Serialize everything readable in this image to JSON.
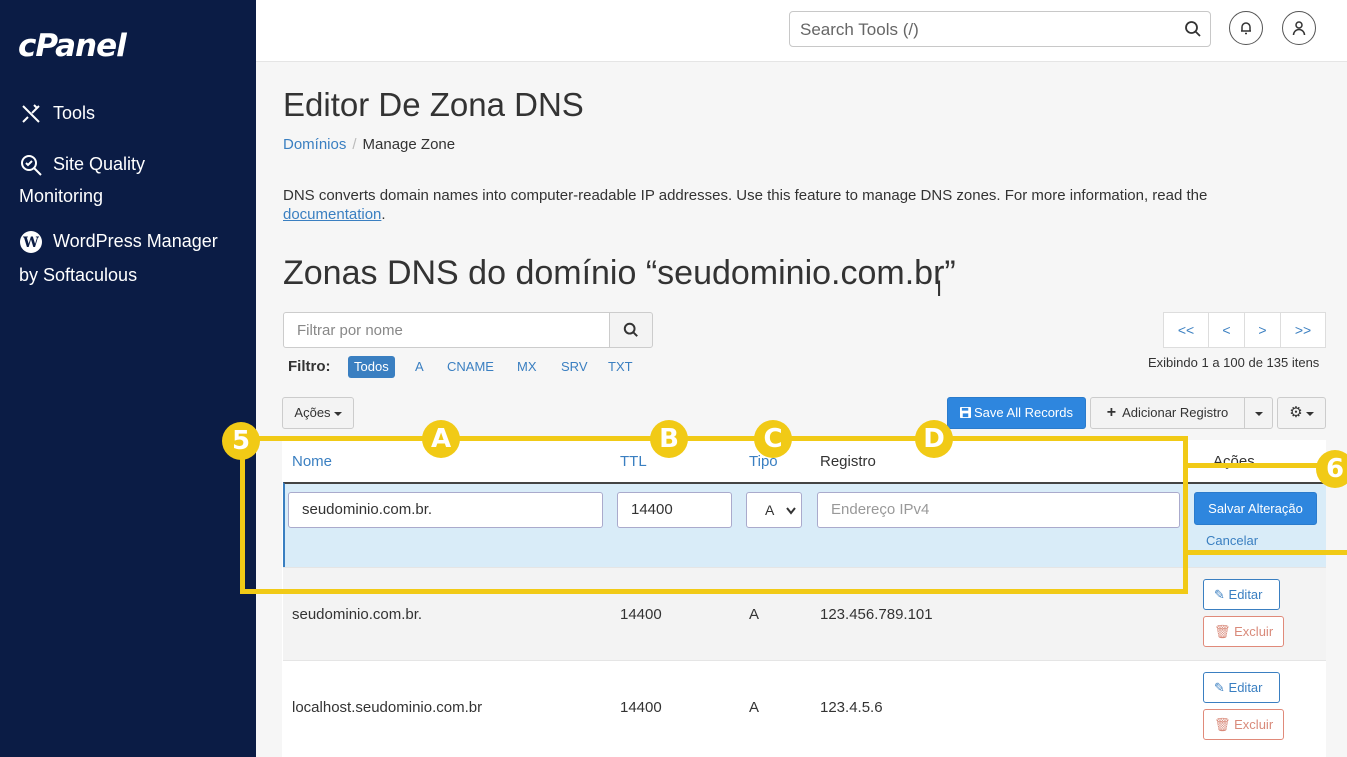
{
  "sidebar": {
    "logo": "cPanel",
    "items": [
      {
        "label": "Tools",
        "icon": "tools-icon"
      },
      {
        "label": "Site Quality",
        "label2": "Monitoring",
        "icon": "site-quality-icon"
      },
      {
        "label": "WordPress Manager",
        "label2": "by Softaculous",
        "icon": "wordpress-icon"
      }
    ]
  },
  "topbar": {
    "search_placeholder": "Search Tools (/)"
  },
  "page": {
    "title": "Editor De Zona DNS",
    "breadcrumb": {
      "parent": "Domínios",
      "sep": "/",
      "current": "Manage Zone"
    },
    "description": "DNS converts domain names into computer-readable IP addresses. Use this feature to manage DNS zones. For more information, read the",
    "doc_link": "documentation",
    "doc_after": ".",
    "zone_title": "Zonas DNS do domínio “seudominio.com.br”"
  },
  "filter": {
    "placeholder": "Filtrar por nome",
    "label": "Filtro:",
    "tabs": [
      "Todos",
      "A",
      "CNAME",
      "MX",
      "SRV",
      "TXT"
    ],
    "active_tab": "Todos"
  },
  "pager": {
    "first": "<<",
    "prev": "<",
    "next": ">",
    "last": ">>",
    "showing": "Exibindo 1 a 100 de 135 itens"
  },
  "toolbar": {
    "actions": "Ações",
    "save_all": "Save All Records",
    "add_record": "Adicionar Registro"
  },
  "table": {
    "headers": {
      "name": "Nome",
      "ttl": "TTL",
      "type": "Tipo",
      "record": "Registro",
      "actions": "Ações"
    },
    "edit_row": {
      "name": "seudominio.com.br.",
      "ttl": "14400",
      "type": "A",
      "record_placeholder": "Endereço IPv4",
      "save": "Salvar Alteração",
      "cancel": "Cancelar"
    },
    "rows": [
      {
        "name": "seudominio.com.br.",
        "ttl": "14400",
        "type": "A",
        "record": "123.456.789.101",
        "edit": "Editar",
        "delete": "Excluir"
      },
      {
        "name": "localhost.seudominio.com.br",
        "ttl": "14400",
        "type": "A",
        "record": "123.4.5.6",
        "edit": "Editar",
        "delete": "Excluir"
      }
    ]
  },
  "annotations": {
    "badge5": "5",
    "badge6": "6",
    "badgeA": "A",
    "badgeB": "B",
    "badgeC": "C",
    "badgeD": "D",
    "color": "#f1ca16"
  }
}
